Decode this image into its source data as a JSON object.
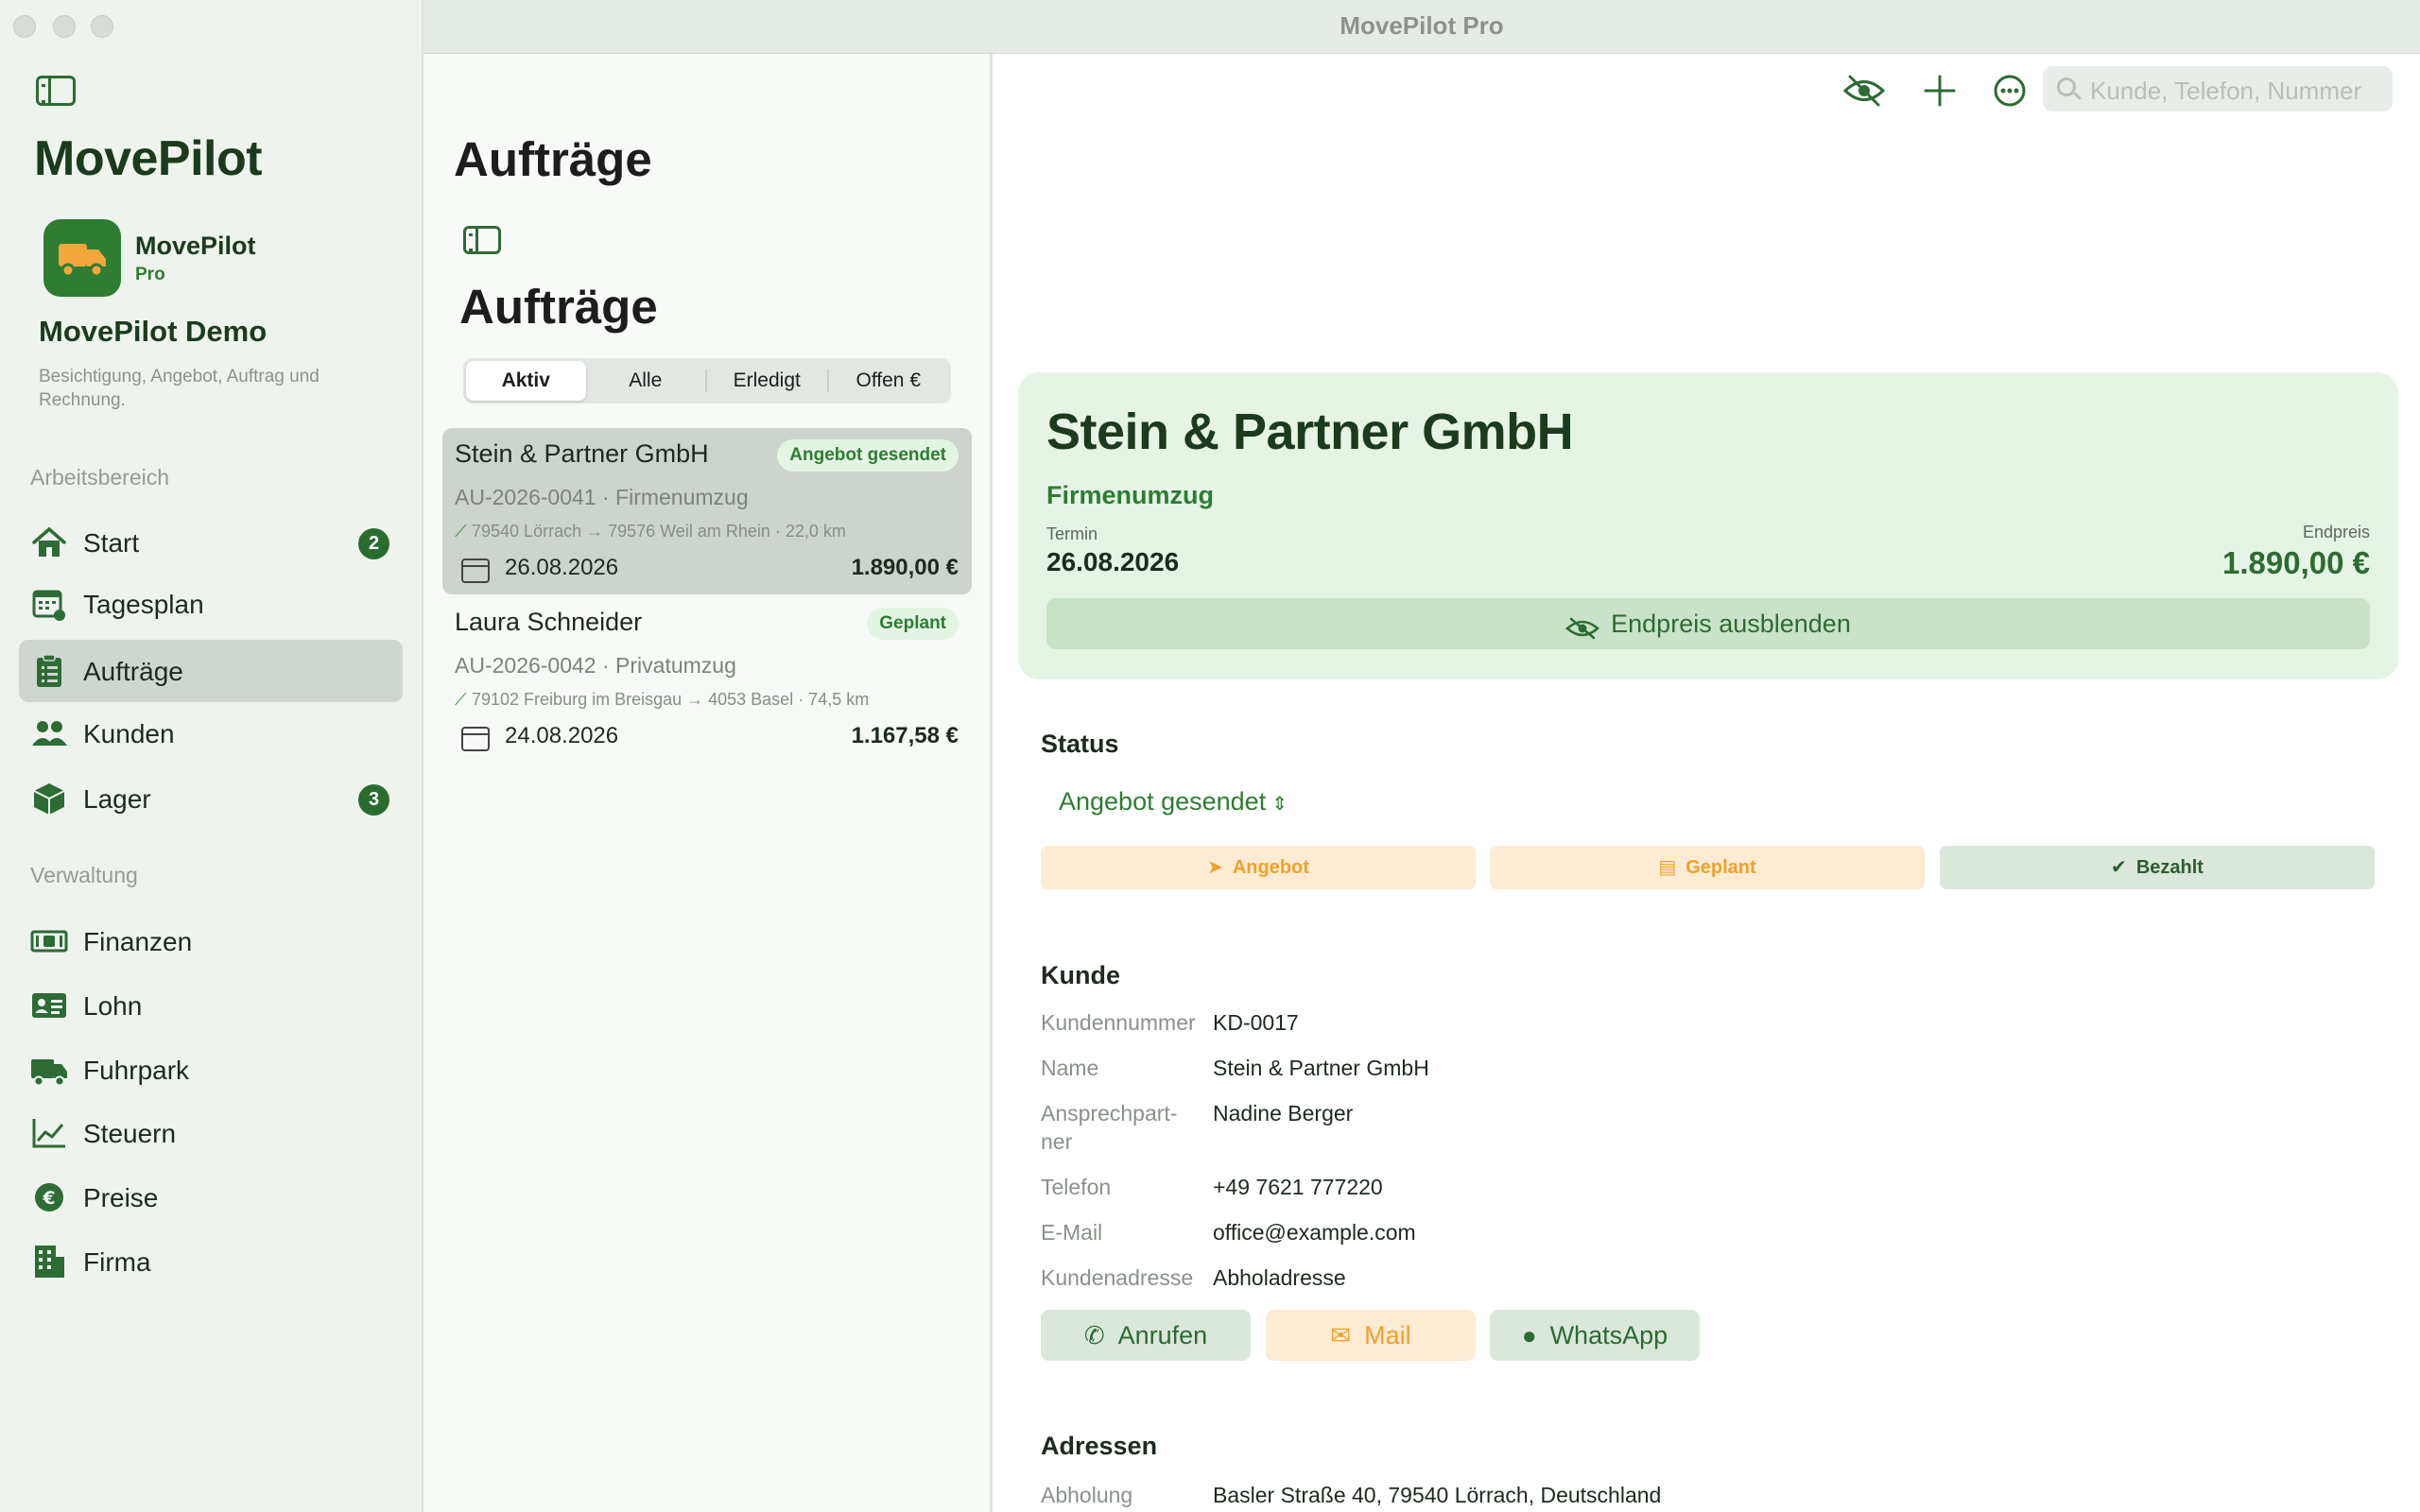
{
  "window": {
    "title": "MovePilot Pro"
  },
  "sidebar": {
    "app_title": "MovePilot",
    "brand_name": "MovePilot",
    "brand_tier": "Pro",
    "company": "MovePilot Demo",
    "company_desc": "Besichtigung, Angebot, Auftrag und Rechnung.",
    "section_workspace": "Arbeitsbereich",
    "section_admin": "Verwaltung",
    "items": [
      {
        "label": "Start",
        "badge": "2",
        "icon": "house-icon"
      },
      {
        "label": "Tagesplan",
        "icon": "calendar-clock-icon"
      },
      {
        "label": "Aufträge",
        "icon": "clipboard-list-icon",
        "active": true
      },
      {
        "label": "Kunden",
        "icon": "people-icon"
      },
      {
        "label": "Lager",
        "badge": "3",
        "icon": "box-icon"
      },
      {
        "label": "Finanzen",
        "icon": "banknote-icon"
      },
      {
        "label": "Lohn",
        "icon": "id-card-icon"
      },
      {
        "label": "Fuhrpark",
        "icon": "truck-icon"
      },
      {
        "label": "Steuern",
        "icon": "chart-line-icon"
      },
      {
        "label": "Preise",
        "icon": "euro-circle-icon"
      },
      {
        "label": "Firma",
        "icon": "building-icon"
      }
    ]
  },
  "list": {
    "title": "Aufträge",
    "subtitle": "Aufträge",
    "segments": [
      "Aktiv",
      "Alle",
      "Erledigt",
      "Offen €"
    ],
    "selected_segment": "Aktiv",
    "orders": [
      {
        "name": "Stein & Partner GmbH",
        "badge": "Angebot gesendet",
        "number": "AU-2026-0041 · Firmenumzug",
        "route": "79540 Lörrach → 79576 Weil am Rhein · 22,0 km",
        "date": "26.08.2026",
        "price": "1.890,00 €"
      },
      {
        "name": "Laura Schneider",
        "badge": "Geplant",
        "number": "AU-2026-0042 · Privatumzug",
        "route": "79102 Freiburg im Breisgau → 4053 Basel · 74,5 km",
        "date": "24.08.2026",
        "price": "1.167,58 €"
      }
    ]
  },
  "toolbar": {
    "search_placeholder": "Kunde, Telefon, Nummer"
  },
  "detail": {
    "name": "Stein & Partner GmbH",
    "type": "Firmenumzug",
    "date_label": "Termin",
    "date": "26.08.2026",
    "price_label": "Endpreis",
    "price": "1.890,00 €",
    "hide_price_button": "Endpreis ausblenden",
    "status_title": "Status",
    "status_value": "Angebot gesendet",
    "status_buttons": [
      "Angebot",
      "Geplant",
      "Bezahlt"
    ],
    "customer_title": "Kunde",
    "customer": [
      {
        "label": "Kundennummer",
        "value": "KD-0017"
      },
      {
        "label": "Name",
        "value": "Stein & Partner GmbH"
      },
      {
        "label": "Ansprechpart-ner",
        "value": "Nadine Berger"
      },
      {
        "label": "Telefon",
        "value": "+49 7621 777220"
      },
      {
        "label": "E-Mail",
        "value": "office@example.com"
      },
      {
        "label": "Kundenadresse",
        "value": "Abholadresse"
      }
    ],
    "actions": [
      "Anrufen",
      "Mail",
      "WhatsApp"
    ],
    "addresses_title": "Adressen",
    "pickup_label": "Abholung",
    "pickup_value": "Basler Straße 40, 79540 Lörrach, Deutschland"
  },
  "colors": {
    "accent": "#2e7d32",
    "orange": "#f0a12b",
    "hero_bg": "#e6f4e6"
  }
}
